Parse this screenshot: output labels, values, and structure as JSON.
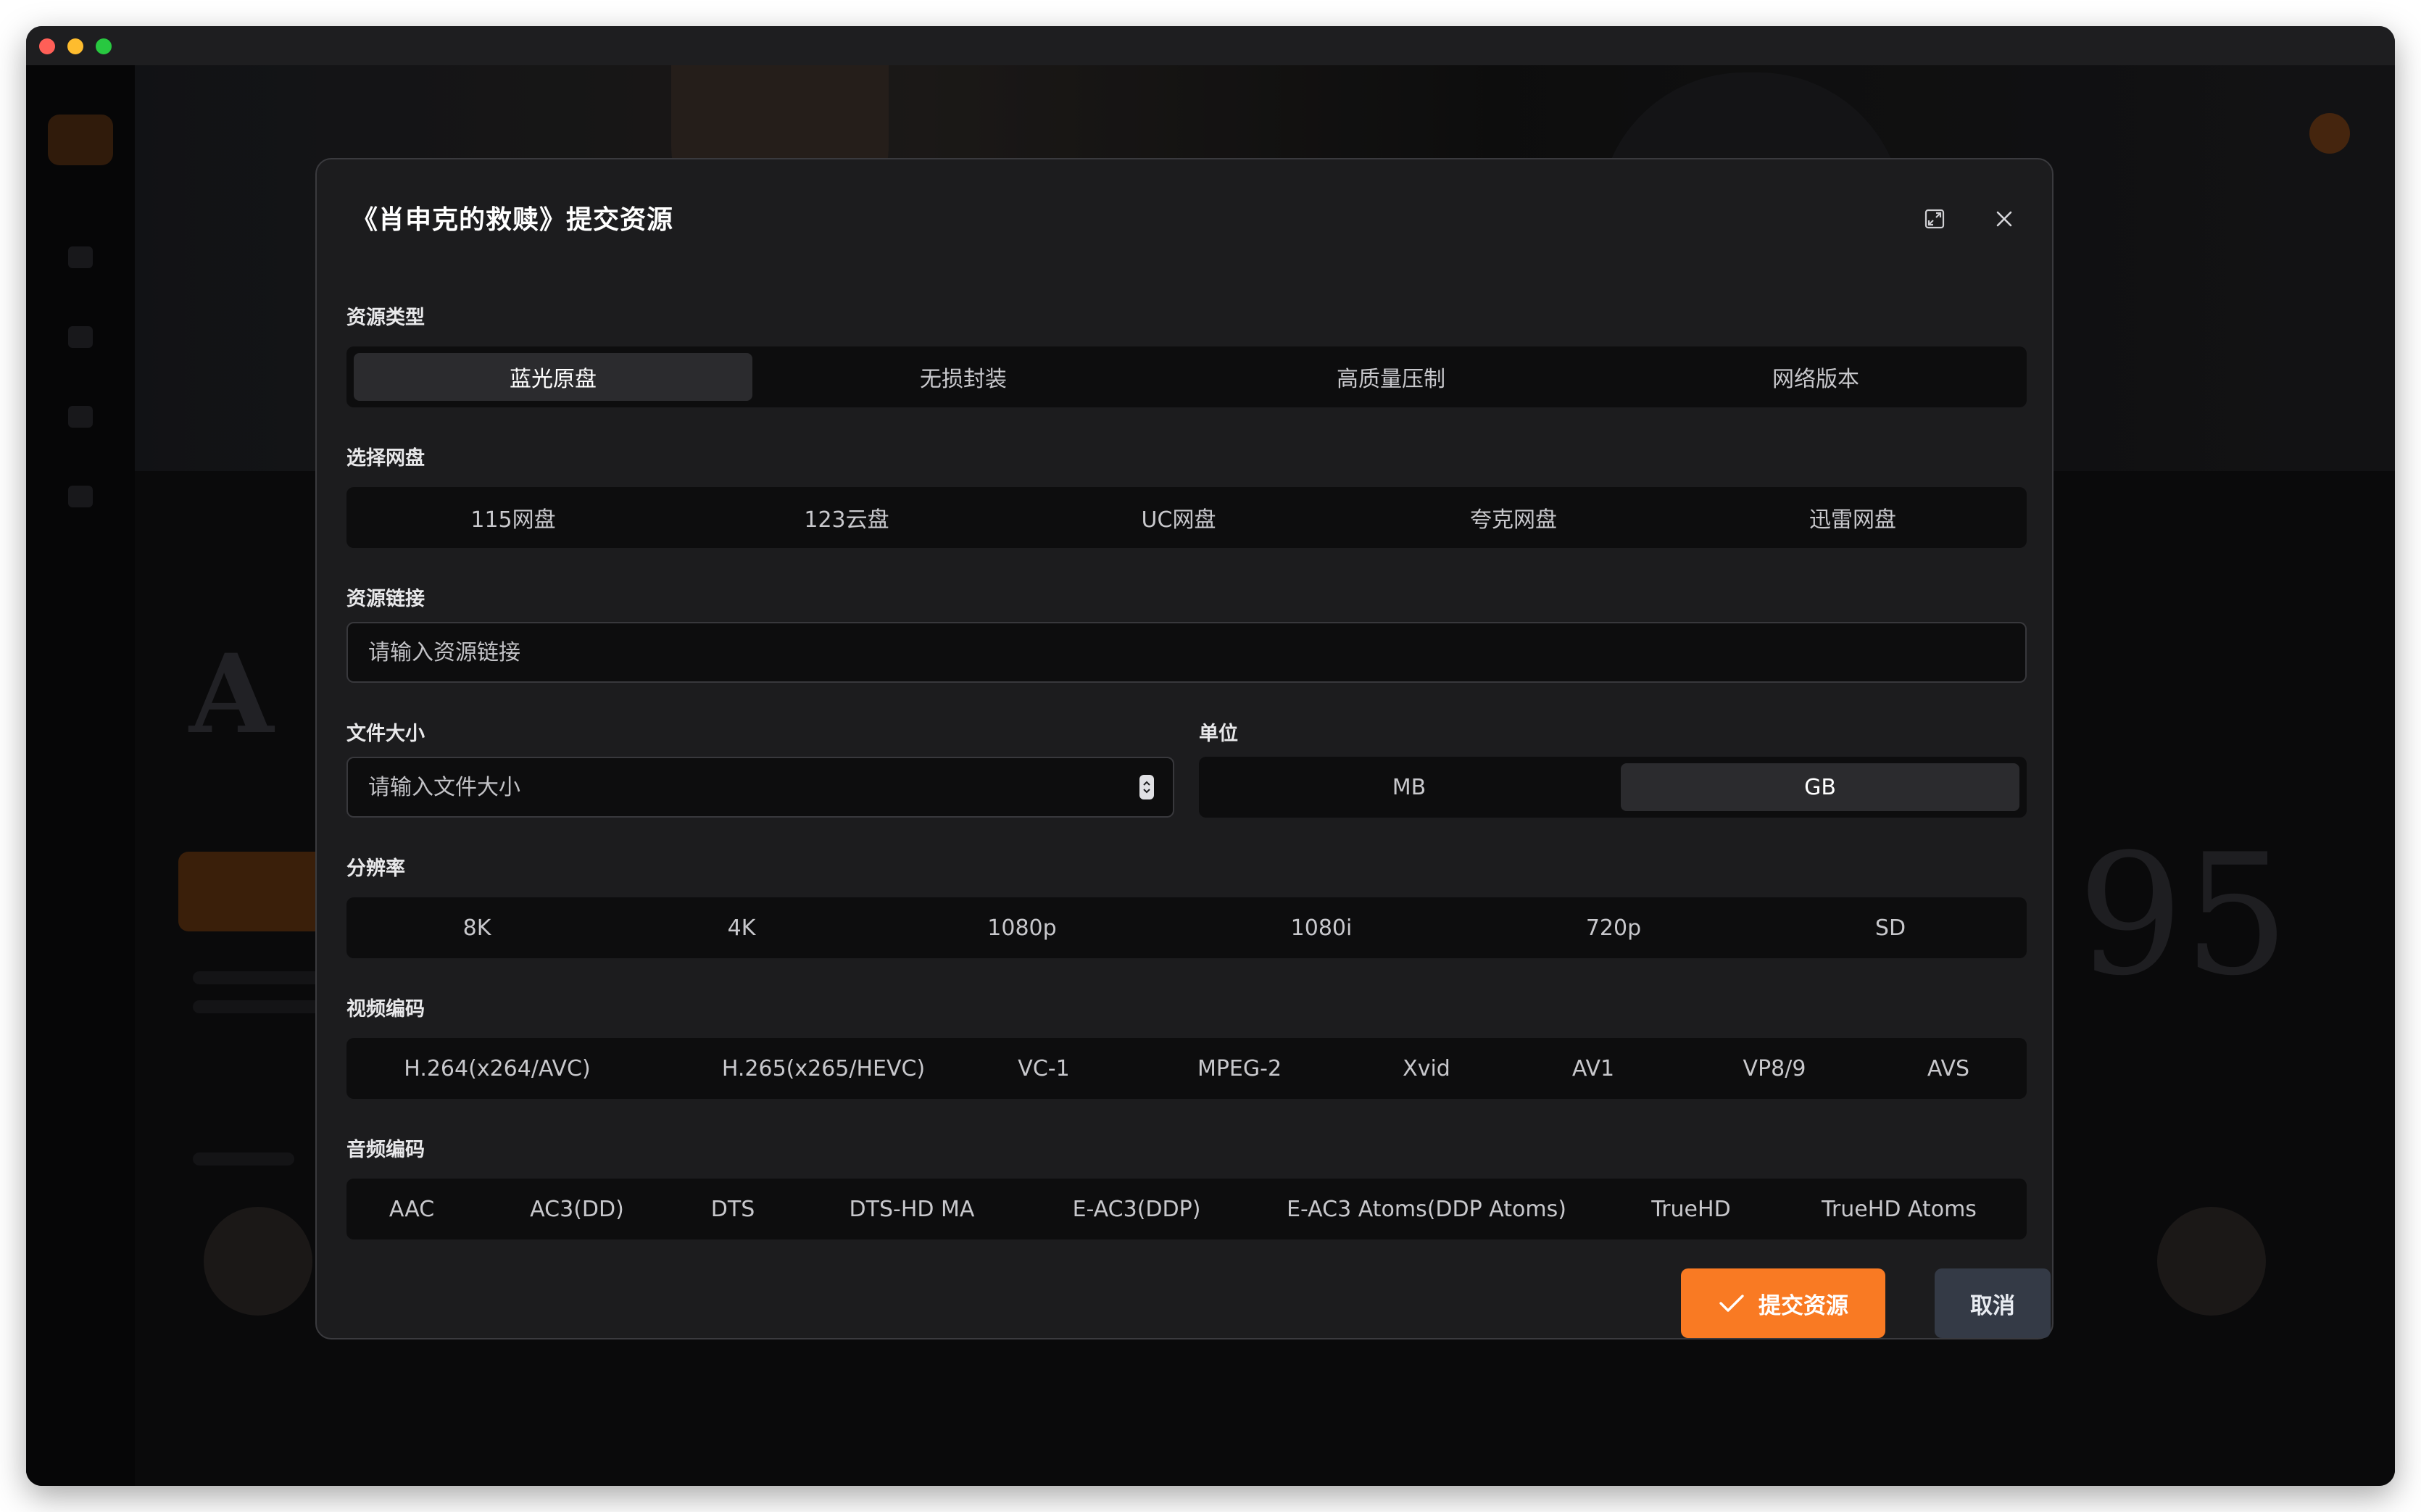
{
  "dialog": {
    "title": "《肖申克的救赎》提交资源"
  },
  "resource_type": {
    "label": "资源类型",
    "options": [
      "蓝光原盘",
      "无损封装",
      "高质量压制",
      "网络版本"
    ],
    "selected": "蓝光原盘"
  },
  "cloud_drive": {
    "label": "选择网盘",
    "options": [
      "115网盘",
      "123云盘",
      "UC网盘",
      "夸克网盘",
      "迅雷网盘"
    ]
  },
  "resource_link": {
    "label": "资源链接",
    "placeholder": "请输入资源链接",
    "value": ""
  },
  "file_size": {
    "label": "文件大小",
    "placeholder": "请输入文件大小",
    "value": ""
  },
  "unit": {
    "label": "单位",
    "options": [
      "MB",
      "GB"
    ],
    "selected": "GB"
  },
  "resolution": {
    "label": "分辨率",
    "options": [
      "8K",
      "4K",
      "1080p",
      "1080i",
      "720p",
      "SD"
    ]
  },
  "video_codec": {
    "label": "视频编码",
    "options": [
      "H.264(x264/AVC)",
      "H.265(x265/HEVC)",
      "VC-1",
      "MPEG-2",
      "Xvid",
      "AV1",
      "VP8/9",
      "AVS"
    ]
  },
  "audio_codec": {
    "label": "音频编码",
    "options": [
      "AAC",
      "AC3(DD)",
      "DTS",
      "DTS-HD MA",
      "E-AC3(DDP)",
      "E-AC3 Atoms(DDP Atoms)",
      "TrueHD",
      "TrueHD Atoms"
    ]
  },
  "actions": {
    "submit_label": "提交资源",
    "cancel_label": "取消"
  },
  "icons": {
    "expand": "expand-icon",
    "close": "close-icon",
    "check": "check-icon",
    "stepper": "stepper-icon"
  },
  "colors": {
    "accent": "#f97a23",
    "dialog_bg": "#1c1c1e",
    "segment_bg": "#0d0d0e",
    "segment_active": "#2b2b2e",
    "cancel_bg": "#343a46"
  }
}
